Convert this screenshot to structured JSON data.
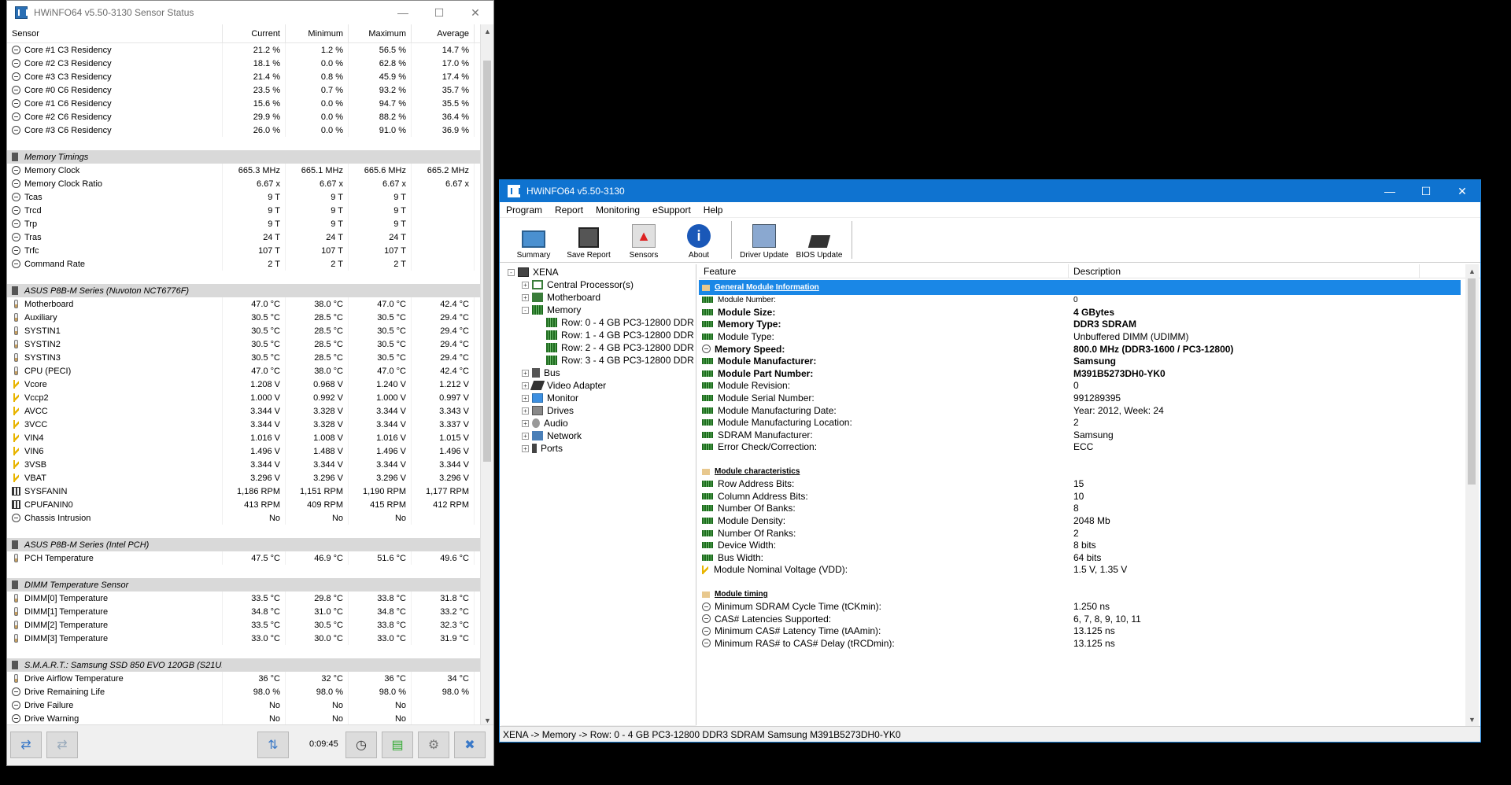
{
  "sensor_window": {
    "title": "HWiNFO64 v5.50-3130 Sensor Status",
    "columns": [
      "Sensor",
      "Current",
      "Minimum",
      "Maximum",
      "Average"
    ],
    "rows": [
      {
        "kind": "item",
        "icon": "clock",
        "name": "Core #1 C3 Residency",
        "cur": "21.2 %",
        "min": "1.2 %",
        "max": "56.5 %",
        "avg": "14.7 %"
      },
      {
        "kind": "item",
        "icon": "clock",
        "name": "Core #2 C3 Residency",
        "cur": "18.1 %",
        "min": "0.0 %",
        "max": "62.8 %",
        "avg": "17.0 %"
      },
      {
        "kind": "item",
        "icon": "clock",
        "name": "Core #3 C3 Residency",
        "cur": "21.4 %",
        "min": "0.8 %",
        "max": "45.9 %",
        "avg": "17.4 %"
      },
      {
        "kind": "item",
        "icon": "clock",
        "name": "Core #0 C6 Residency",
        "cur": "23.5 %",
        "min": "0.7 %",
        "max": "93.2 %",
        "avg": "35.7 %"
      },
      {
        "kind": "item",
        "icon": "clock",
        "name": "Core #1 C6 Residency",
        "cur": "15.6 %",
        "min": "0.0 %",
        "max": "94.7 %",
        "avg": "35.5 %"
      },
      {
        "kind": "item",
        "icon": "clock",
        "name": "Core #2 C6 Residency",
        "cur": "29.9 %",
        "min": "0.0 %",
        "max": "88.2 %",
        "avg": "36.4 %"
      },
      {
        "kind": "item",
        "icon": "clock",
        "name": "Core #3 C6 Residency",
        "cur": "26.0 %",
        "min": "0.0 %",
        "max": "91.0 %",
        "avg": "36.9 %"
      },
      {
        "kind": "spacer"
      },
      {
        "kind": "group",
        "name": "Memory Timings"
      },
      {
        "kind": "item",
        "icon": "clock",
        "name": "Memory Clock",
        "cur": "665.3 MHz",
        "min": "665.1 MHz",
        "max": "665.6 MHz",
        "avg": "665.2 MHz"
      },
      {
        "kind": "item",
        "icon": "clock",
        "name": "Memory Clock Ratio",
        "cur": "6.67 x",
        "min": "6.67 x",
        "max": "6.67 x",
        "avg": "6.67 x"
      },
      {
        "kind": "item",
        "icon": "clock",
        "name": "Tcas",
        "cur": "9 T",
        "min": "9 T",
        "max": "9 T",
        "avg": ""
      },
      {
        "kind": "item",
        "icon": "clock",
        "name": "Trcd",
        "cur": "9 T",
        "min": "9 T",
        "max": "9 T",
        "avg": ""
      },
      {
        "kind": "item",
        "icon": "clock",
        "name": "Trp",
        "cur": "9 T",
        "min": "9 T",
        "max": "9 T",
        "avg": ""
      },
      {
        "kind": "item",
        "icon": "clock",
        "name": "Tras",
        "cur": "24 T",
        "min": "24 T",
        "max": "24 T",
        "avg": ""
      },
      {
        "kind": "item",
        "icon": "clock",
        "name": "Trfc",
        "cur": "107 T",
        "min": "107 T",
        "max": "107 T",
        "avg": ""
      },
      {
        "kind": "item",
        "icon": "clock",
        "name": "Command Rate",
        "cur": "2 T",
        "min": "2 T",
        "max": "2 T",
        "avg": ""
      },
      {
        "kind": "spacer"
      },
      {
        "kind": "group",
        "name": "ASUS P8B-M Series (Nuvoton NCT6776F)"
      },
      {
        "kind": "item",
        "icon": "temp",
        "name": "Motherboard",
        "cur": "47.0 °C",
        "min": "38.0 °C",
        "max": "47.0 °C",
        "avg": "42.4 °C"
      },
      {
        "kind": "item",
        "icon": "temp",
        "name": "Auxiliary",
        "cur": "30.5 °C",
        "min": "28.5 °C",
        "max": "30.5 °C",
        "avg": "29.4 °C"
      },
      {
        "kind": "item",
        "icon": "temp",
        "name": "SYSTIN1",
        "cur": "30.5 °C",
        "min": "28.5 °C",
        "max": "30.5 °C",
        "avg": "29.4 °C"
      },
      {
        "kind": "item",
        "icon": "temp",
        "name": "SYSTIN2",
        "cur": "30.5 °C",
        "min": "28.5 °C",
        "max": "30.5 °C",
        "avg": "29.4 °C"
      },
      {
        "kind": "item",
        "icon": "temp",
        "name": "SYSTIN3",
        "cur": "30.5 °C",
        "min": "28.5 °C",
        "max": "30.5 °C",
        "avg": "29.4 °C"
      },
      {
        "kind": "item",
        "icon": "temp",
        "name": "CPU (PECI)",
        "cur": "47.0 °C",
        "min": "38.0 °C",
        "max": "47.0 °C",
        "avg": "42.4 °C"
      },
      {
        "kind": "item",
        "icon": "volt",
        "name": "Vcore",
        "cur": "1.208 V",
        "min": "0.968 V",
        "max": "1.240 V",
        "avg": "1.212 V"
      },
      {
        "kind": "item",
        "icon": "volt",
        "name": "Vccp2",
        "cur": "1.000 V",
        "min": "0.992 V",
        "max": "1.000 V",
        "avg": "0.997 V"
      },
      {
        "kind": "item",
        "icon": "volt",
        "name": "AVCC",
        "cur": "3.344 V",
        "min": "3.328 V",
        "max": "3.344 V",
        "avg": "3.343 V"
      },
      {
        "kind": "item",
        "icon": "volt",
        "name": "3VCC",
        "cur": "3.344 V",
        "min": "3.328 V",
        "max": "3.344 V",
        "avg": "3.337 V"
      },
      {
        "kind": "item",
        "icon": "volt",
        "name": "VIN4",
        "cur": "1.016 V",
        "min": "1.008 V",
        "max": "1.016 V",
        "avg": "1.015 V"
      },
      {
        "kind": "item",
        "icon": "volt",
        "name": "VIN6",
        "cur": "1.496 V",
        "min": "1.488 V",
        "max": "1.496 V",
        "avg": "1.496 V"
      },
      {
        "kind": "item",
        "icon": "volt",
        "name": "3VSB",
        "cur": "3.344 V",
        "min": "3.344 V",
        "max": "3.344 V",
        "avg": "3.344 V"
      },
      {
        "kind": "item",
        "icon": "volt",
        "name": "VBAT",
        "cur": "3.296 V",
        "min": "3.296 V",
        "max": "3.296 V",
        "avg": "3.296 V"
      },
      {
        "kind": "item",
        "icon": "fan",
        "name": "SYSFANIN",
        "cur": "1,186 RPM",
        "min": "1,151 RPM",
        "max": "1,190 RPM",
        "avg": "1,177 RPM"
      },
      {
        "kind": "item",
        "icon": "fan",
        "name": "CPUFANIN0",
        "cur": "413 RPM",
        "min": "409 RPM",
        "max": "415 RPM",
        "avg": "412 RPM"
      },
      {
        "kind": "item",
        "icon": "clock",
        "name": "Chassis Intrusion",
        "cur": "No",
        "min": "No",
        "max": "No",
        "avg": ""
      },
      {
        "kind": "spacer"
      },
      {
        "kind": "group",
        "name": "ASUS P8B-M Series (Intel PCH)"
      },
      {
        "kind": "item",
        "icon": "temp",
        "name": "PCH Temperature",
        "cur": "47.5 °C",
        "min": "46.9 °C",
        "max": "51.6 °C",
        "avg": "49.6 °C"
      },
      {
        "kind": "spacer"
      },
      {
        "kind": "group",
        "name": "DIMM Temperature Sensor"
      },
      {
        "kind": "item",
        "icon": "temp",
        "name": "DIMM[0] Temperature",
        "cur": "33.5 °C",
        "min": "29.8 °C",
        "max": "33.8 °C",
        "avg": "31.8 °C"
      },
      {
        "kind": "item",
        "icon": "temp",
        "name": "DIMM[1] Temperature",
        "cur": "34.8 °C",
        "min": "31.0 °C",
        "max": "34.8 °C",
        "avg": "33.2 °C"
      },
      {
        "kind": "item",
        "icon": "temp",
        "name": "DIMM[2] Temperature",
        "cur": "33.5 °C",
        "min": "30.5 °C",
        "max": "33.8 °C",
        "avg": "32.3 °C"
      },
      {
        "kind": "item",
        "icon": "temp",
        "name": "DIMM[3] Temperature",
        "cur": "33.0 °C",
        "min": "30.0 °C",
        "max": "33.0 °C",
        "avg": "31.9 °C"
      },
      {
        "kind": "spacer"
      },
      {
        "kind": "group",
        "name": "S.M.A.R.T.: Samsung SSD 850 EVO 120GB (S21U..."
      },
      {
        "kind": "item",
        "icon": "temp",
        "name": "Drive Airflow Temperature",
        "cur": "36 °C",
        "min": "32 °C",
        "max": "36 °C",
        "avg": "34 °C"
      },
      {
        "kind": "item",
        "icon": "clock",
        "name": "Drive Remaining Life",
        "cur": "98.0 %",
        "min": "98.0 %",
        "max": "98.0 %",
        "avg": "98.0 %"
      },
      {
        "kind": "item",
        "icon": "clock",
        "name": "Drive Failure",
        "cur": "No",
        "min": "No",
        "max": "No",
        "avg": ""
      },
      {
        "kind": "item",
        "icon": "clock",
        "name": "Drive Warning",
        "cur": "No",
        "min": "No",
        "max": "No",
        "avg": ""
      }
    ],
    "timer": "0:09:45"
  },
  "main_window": {
    "title": "HWiNFO64 v5.50-3130",
    "menu": [
      "Program",
      "Report",
      "Monitoring",
      "eSupport",
      "Help"
    ],
    "toolbar": [
      "Summary",
      "Save Report",
      "Sensors",
      "About",
      "Driver Update",
      "BIOS Update"
    ],
    "tree": [
      {
        "label": "XENA",
        "icon": "computer",
        "level": 0,
        "exp": "-"
      },
      {
        "label": "Central Processor(s)",
        "icon": "cpu",
        "level": 1,
        "exp": "+"
      },
      {
        "label": "Motherboard",
        "icon": "mb",
        "level": 1,
        "exp": "+"
      },
      {
        "label": "Memory",
        "icon": "mem",
        "level": 1,
        "exp": "-"
      },
      {
        "label": "Row: 0 - 4 GB PC3-12800 DDR",
        "icon": "mem",
        "level": 2,
        "exp": ""
      },
      {
        "label": "Row: 1 - 4 GB PC3-12800 DDR",
        "icon": "mem",
        "level": 2,
        "exp": ""
      },
      {
        "label": "Row: 2 - 4 GB PC3-12800 DDR",
        "icon": "mem",
        "level": 2,
        "exp": ""
      },
      {
        "label": "Row: 3 - 4 GB PC3-12800 DDR",
        "icon": "mem",
        "level": 2,
        "exp": ""
      },
      {
        "label": "Bus",
        "icon": "bus",
        "level": 1,
        "exp": "+"
      },
      {
        "label": "Video Adapter",
        "icon": "video",
        "level": 1,
        "exp": "+"
      },
      {
        "label": "Monitor",
        "icon": "monitor",
        "level": 1,
        "exp": "+"
      },
      {
        "label": "Drives",
        "icon": "drive",
        "level": 1,
        "exp": "+"
      },
      {
        "label": "Audio",
        "icon": "audio",
        "level": 1,
        "exp": "+"
      },
      {
        "label": "Network",
        "icon": "net",
        "level": 1,
        "exp": "+"
      },
      {
        "label": "Ports",
        "icon": "port",
        "level": 1,
        "exp": "+"
      }
    ],
    "detail_columns": [
      "Feature",
      "Description"
    ],
    "details": [
      {
        "kind": "section",
        "feature": "General Module Information",
        "selected": true
      },
      {
        "kind": "item",
        "icon": "dimm",
        "feature": "Module Number:",
        "value": "0",
        "small": true
      },
      {
        "kind": "item",
        "icon": "dimm",
        "feature": "Module Size:",
        "value": "4 GBytes",
        "bold": true
      },
      {
        "kind": "item",
        "icon": "dimm",
        "feature": "Memory Type:",
        "value": "DDR3 SDRAM",
        "bold": true
      },
      {
        "kind": "item",
        "icon": "dimm",
        "feature": "Module Type:",
        "value": "Unbuffered DIMM (UDIMM)"
      },
      {
        "kind": "item",
        "icon": "clock",
        "feature": "Memory Speed:",
        "value": "800.0 MHz (DDR3-1600 / PC3-12800)",
        "bold": true
      },
      {
        "kind": "item",
        "icon": "dimm",
        "feature": "Module Manufacturer:",
        "value": "Samsung",
        "bold": true
      },
      {
        "kind": "item",
        "icon": "dimm",
        "feature": "Module Part Number:",
        "value": "M391B5273DH0-YK0",
        "bold": true
      },
      {
        "kind": "item",
        "icon": "dimm",
        "feature": "Module Revision:",
        "value": "0"
      },
      {
        "kind": "item",
        "icon": "dimm",
        "feature": "Module Serial Number:",
        "value": "991289395"
      },
      {
        "kind": "item",
        "icon": "dimm",
        "feature": "Module Manufacturing Date:",
        "value": "Year: 2012, Week: 24"
      },
      {
        "kind": "item",
        "icon": "dimm",
        "feature": "Module Manufacturing Location:",
        "value": "2"
      },
      {
        "kind": "item",
        "icon": "dimm",
        "feature": "SDRAM Manufacturer:",
        "value": "Samsung"
      },
      {
        "kind": "item",
        "icon": "dimm",
        "feature": "Error Check/Correction:",
        "value": "ECC"
      },
      {
        "kind": "blank"
      },
      {
        "kind": "section",
        "feature": "Module characteristics"
      },
      {
        "kind": "item",
        "icon": "dimm",
        "feature": "Row Address Bits:",
        "value": "15"
      },
      {
        "kind": "item",
        "icon": "dimm",
        "feature": "Column Address Bits:",
        "value": "10"
      },
      {
        "kind": "item",
        "icon": "dimm",
        "feature": "Number Of Banks:",
        "value": "8"
      },
      {
        "kind": "item",
        "icon": "dimm",
        "feature": "Module Density:",
        "value": "2048 Mb"
      },
      {
        "kind": "item",
        "icon": "dimm",
        "feature": "Number Of Ranks:",
        "value": "2"
      },
      {
        "kind": "item",
        "icon": "dimm",
        "feature": "Device Width:",
        "value": "8 bits"
      },
      {
        "kind": "item",
        "icon": "dimm",
        "feature": "Bus Width:",
        "value": "64 bits"
      },
      {
        "kind": "item",
        "icon": "volt",
        "feature": "Module Nominal Voltage (VDD):",
        "value": "1.5 V, 1.35 V"
      },
      {
        "kind": "blank"
      },
      {
        "kind": "section",
        "feature": "Module timing"
      },
      {
        "kind": "item",
        "icon": "clock",
        "feature": "Minimum SDRAM Cycle Time (tCKmin):",
        "value": "1.250 ns"
      },
      {
        "kind": "item",
        "icon": "clock",
        "feature": "CAS# Latencies Supported:",
        "value": "6, 7, 8, 9, 10, 11"
      },
      {
        "kind": "item",
        "icon": "clock",
        "feature": "Minimum CAS# Latency Time (tAAmin):",
        "value": "13.125 ns"
      },
      {
        "kind": "item",
        "icon": "clock",
        "feature": "Minimum RAS# to CAS# Delay (tRCDmin):",
        "value": "13.125 ns"
      }
    ],
    "statusbar": "XENA -> Memory -> Row: 0 - 4 GB PC3-12800 DDR3 SDRAM Samsung M391B5273DH0-YK0"
  }
}
